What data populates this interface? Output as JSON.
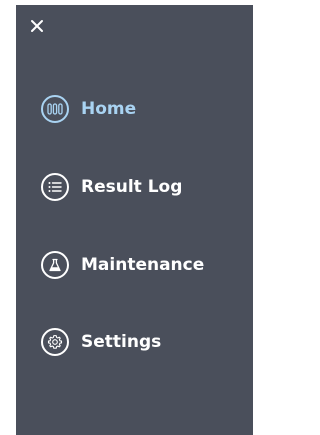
{
  "drawer": {
    "close_icon": "close-icon",
    "active_color": "#a9d3f2",
    "background_color": "#4a4f5b",
    "items": [
      {
        "label": "Home",
        "icon": "test-tubes-icon",
        "active": true
      },
      {
        "label": "Result Log",
        "icon": "list-icon",
        "active": false
      },
      {
        "label": "Maintenance",
        "icon": "flask-icon",
        "active": false
      },
      {
        "label": "Settings",
        "icon": "gear-icon",
        "active": false
      }
    ]
  }
}
